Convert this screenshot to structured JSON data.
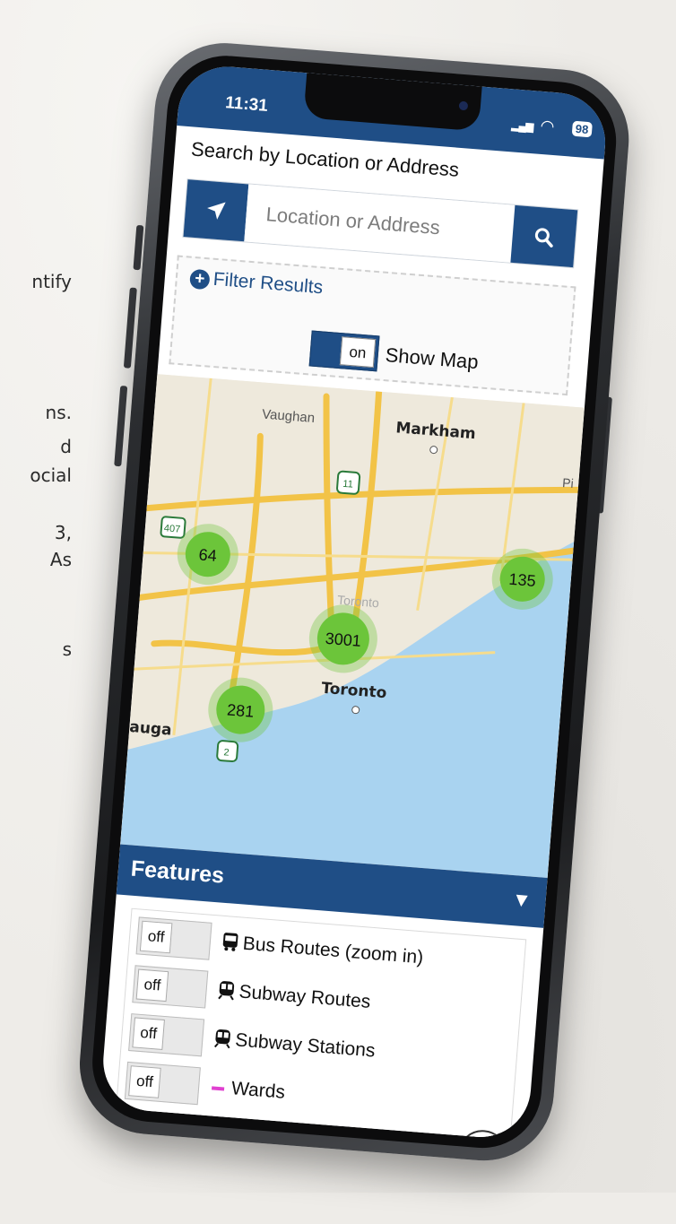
{
  "status": {
    "time": "11:31",
    "battery": "98"
  },
  "background_text": [
    "ntify",
    "ns.",
    "d",
    "ocial",
    "3,",
    "As",
    "s"
  ],
  "search": {
    "heading": "Search by Location or Address",
    "placeholder": "Location or Address"
  },
  "filter": {
    "label": "Filter Results",
    "plus_glyph": "+"
  },
  "show_map": {
    "toggle_state": "on",
    "label": "Show Map"
  },
  "map": {
    "place_labels": [
      "Vaughan",
      "Markham",
      "Pi",
      "Toronto",
      "Toronto",
      "auga"
    ],
    "highway_shields": [
      "407",
      "11",
      "2"
    ],
    "clusters": [
      "64",
      "135",
      "3001",
      "281"
    ],
    "colors": {
      "land": "#eee9dc",
      "water": "#a9d3f0",
      "highway": "#f2c347",
      "cluster": "#6cc53a"
    }
  },
  "features": {
    "title": "Features",
    "arrow": "▼",
    "items": [
      {
        "toggle": "off",
        "label": "Bus Routes (zoom in)"
      },
      {
        "toggle": "off",
        "label": "Subway Routes"
      },
      {
        "toggle": "off",
        "label": "Subway Stations"
      },
      {
        "toggle": "off",
        "label": "Wards"
      }
    ]
  },
  "colors": {
    "brand_blue": "#1f4e86",
    "ward_magenta": "#e040d0"
  }
}
